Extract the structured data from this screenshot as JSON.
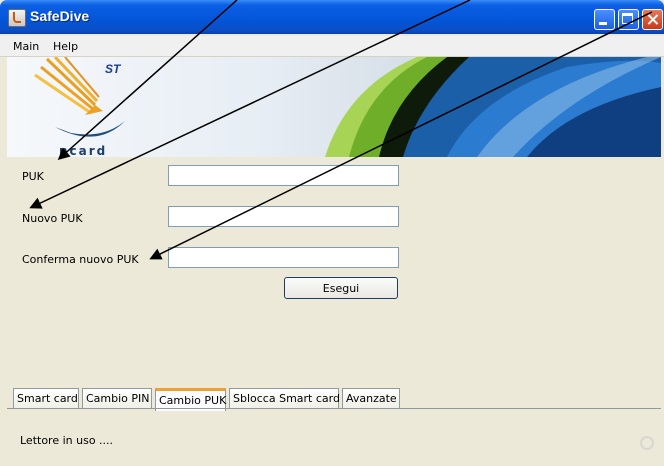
{
  "window": {
    "title": "SafeDive"
  },
  "menu": {
    "items": [
      "Main",
      "Help"
    ]
  },
  "banner": {
    "card_logo_text": "ncard"
  },
  "form": {
    "fields": [
      {
        "label": "PUK",
        "value": ""
      },
      {
        "label": "Nuovo PUK",
        "value": ""
      },
      {
        "label": "Conferma nuovo PUK",
        "value": ""
      }
    ],
    "submit_label": "Esegui"
  },
  "tabs": [
    {
      "label": "Smart card",
      "active": false
    },
    {
      "label": "Cambio PIN",
      "active": false
    },
    {
      "label": "Cambio PUK",
      "active": true
    },
    {
      "label": "Sblocca Smart card",
      "active": false
    },
    {
      "label": "Avanzate",
      "active": false
    }
  ],
  "status": {
    "text": "Lettore in uso ...."
  },
  "colors": {
    "title_bar": "#0455d8",
    "window_bg": "#ece9d8",
    "banner_green": "#8ac234",
    "banner_blue": "#1b5fa8",
    "active_tab_accent": "#f0a030"
  }
}
